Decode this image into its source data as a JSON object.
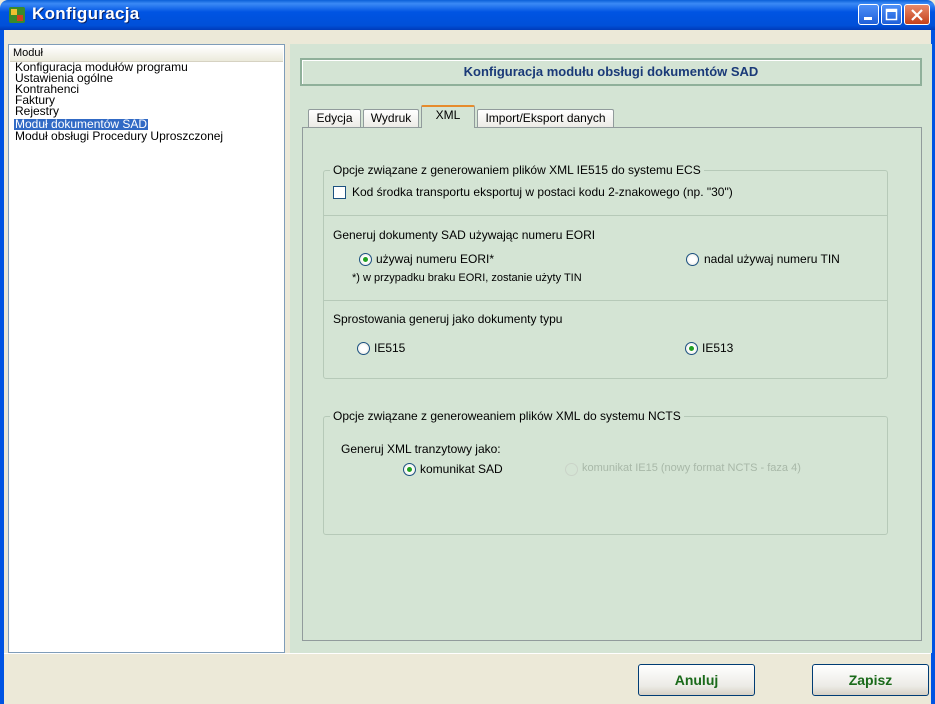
{
  "window": {
    "title": "Konfiguracja"
  },
  "sidebar": {
    "header": "Moduł",
    "items": [
      {
        "label": "Konfiguracja modułów programu"
      },
      {
        "label": "Ustawienia ogólne"
      },
      {
        "label": "Kontrahenci"
      },
      {
        "label": "Faktury"
      },
      {
        "label": "Rejestry"
      },
      {
        "label": "Moduł dokumentów SAD",
        "selected": true
      },
      {
        "label": "Moduł obsługi Procedury Uproszczonej"
      }
    ]
  },
  "main": {
    "header_title": "Konfiguracja modułu obsługi dokumentów SAD",
    "tabs": [
      {
        "label": "Edycja"
      },
      {
        "label": "Wydruk"
      },
      {
        "label": "XML",
        "active": true
      },
      {
        "label": "Import/Eksport danych"
      }
    ],
    "ecs_group": {
      "legend": "Opcje związane z generowaniem plików XML IE515 do systemu ECS",
      "checkbox_label": "Kod środka transportu eksportuj w postaci kodu 2-znakowego (np. \"30\")",
      "checkbox_checked": false,
      "eori_title": "Generuj dokumenty SAD używając numeru EORI",
      "eori_option_use": "używaj numeru EORI*",
      "eori_option_tin": "nadal używaj numeru TIN",
      "eori_note": "*) w przypadku braku EORI, zostanie użyty TIN",
      "eori_selected": "use",
      "correction_title": "Sprostowania generuj jako dokumenty typu",
      "correction_option_1": "IE515",
      "correction_option_2": "IE513",
      "correction_selected": "IE513"
    },
    "ncts_group": {
      "legend": "Opcje związane z generoweaniem plików XML do systemu NCTS",
      "title": "Generuj XML tranzytowy jako:",
      "option_sad": "komunikat SAD",
      "option_ie15": "komunikat IE15 (nowy format NCTS - faza 4)",
      "selected": "sad"
    }
  },
  "footer": {
    "cancel_label": "Anuluj",
    "save_label": "Zapisz"
  },
  "colors": {
    "titlebar": "#0054e3",
    "panel": "#d4e4d4",
    "header_text": "#1a3a78",
    "button_text": "#1a6a1a",
    "selection": "#316ac5"
  }
}
